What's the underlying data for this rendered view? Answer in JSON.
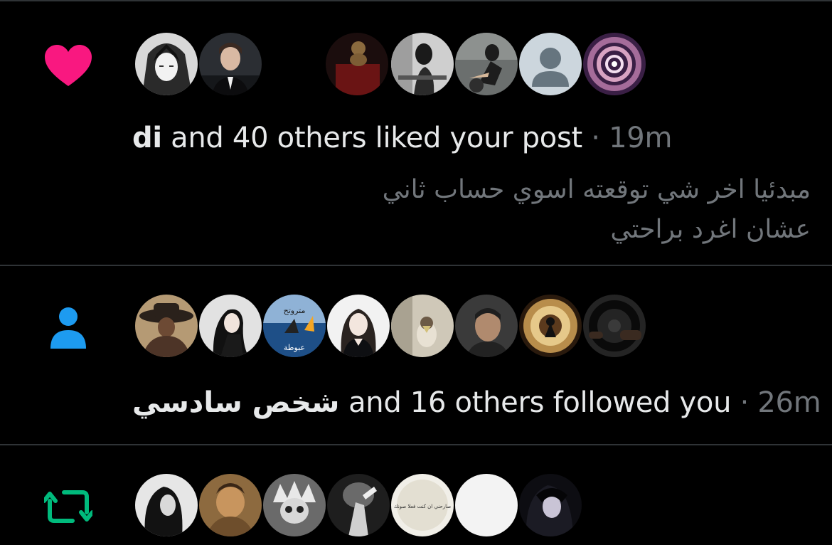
{
  "notifications": [
    {
      "type_icon": "heart-icon",
      "color": "#f91880",
      "actor": "di",
      "action": " and 40 others liked your post",
      "separator": " · ",
      "time": "19m",
      "post_line_1": "مبدئيا اخر شي توقعته اسوي حساب ثاني",
      "post_line_2": "عشان اغرد براحتي"
    },
    {
      "type_icon": "person-icon",
      "color": "#1d9bf0",
      "actor": "شخص سادسي",
      "action": " and 16 others followed you",
      "separator": " · ",
      "time": "26m"
    },
    {
      "type_icon": "retweet-icon",
      "color": "#00ba7c"
    }
  ],
  "avatar_captions": {
    "shark_top": "متروتح",
    "shark_bottom": "عبوطة",
    "round_text": "صارحني ان كنت فعلا صونك"
  }
}
